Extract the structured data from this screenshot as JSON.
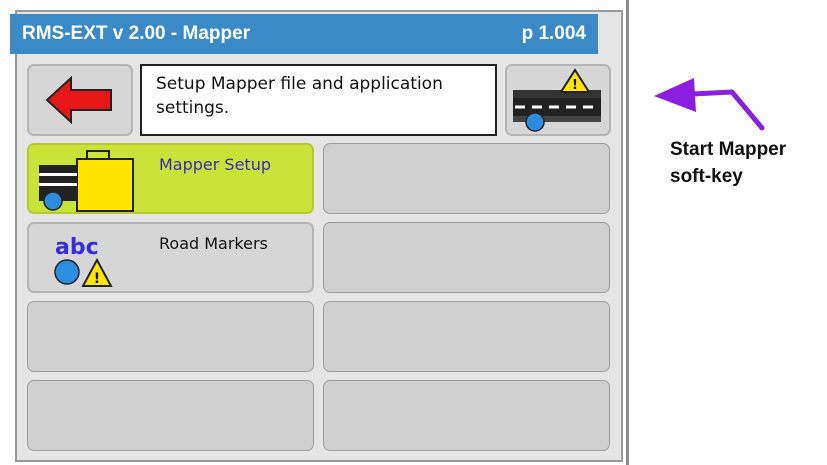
{
  "header": {
    "title": "RMS-EXT v 2.00 - Mapper",
    "page": "p 1.004"
  },
  "description": {
    "line1": "Setup Mapper file and application",
    "line2": "settings."
  },
  "buttons": {
    "back": {
      "icon": "red-left-arrow-icon"
    },
    "start_mapper": {
      "icon": "road-warning-icon"
    }
  },
  "menu": [
    {
      "label": "Mapper Setup",
      "state": "selected",
      "icon": "vehicle-briefcase-icon",
      "color": "#c9e339",
      "label_color": "#3a2bb0"
    },
    {
      "label": "Road Markers",
      "state": "normal",
      "icon": "abc-circle-warning-icon"
    }
  ],
  "annotation": {
    "line1": "Start Mapper",
    "line2": "soft-key",
    "arrow_color": "#8a1fe0"
  },
  "colors": {
    "header_blue": "#3a8ac8",
    "tile_gray": "#cfcfcf",
    "back_red": "#e81717",
    "warning_yellow": "#ffe500",
    "marker_blue": "#2a8de0"
  }
}
